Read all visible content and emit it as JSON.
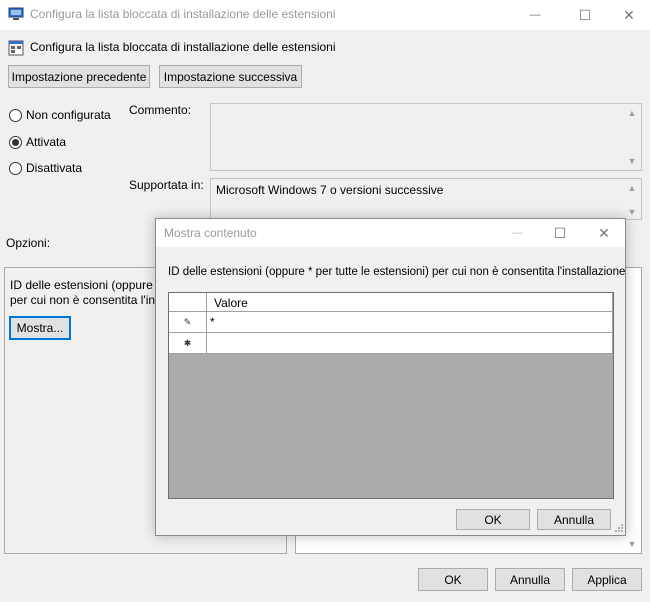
{
  "window": {
    "title": "Configura la lista bloccata di installazione delle estensioni",
    "minimize": "—",
    "maximize": "☐",
    "close": "✕"
  },
  "header": {
    "policy_title": "Configura la lista bloccata di installazione delle estensioni"
  },
  "nav": {
    "prev_label": "Impostazione precedente",
    "next_label": "Impostazione successiva"
  },
  "state": {
    "options": [
      {
        "label": "Non configurata",
        "checked": false
      },
      {
        "label": "Attivata",
        "checked": true
      },
      {
        "label": "Disattivata",
        "checked": false
      }
    ]
  },
  "comment": {
    "label": "Commento:",
    "value": ""
  },
  "supported": {
    "label": "Supportata in:",
    "value": "Microsoft Windows 7 o versioni successive"
  },
  "options_section": {
    "label": "Opzioni:",
    "description": "ID delle estensioni (oppure * per tutte le estensioni) per cui non è consentita l'installazione",
    "description_line1": "ID delle estensioni (oppure * p",
    "description_line2": "per cui non è consentita l'insta",
    "show_button": "Mostra..."
  },
  "footer": {
    "ok_label": "OK",
    "cancel_label": "Annulla",
    "apply_label": "Applica"
  },
  "dialog": {
    "title": "Mostra contenuto",
    "description": "ID delle estensioni (oppure * per tutte le estensioni) per cui non è consentita l'installazione",
    "column_header": "Valore",
    "rows": [
      {
        "marker": "✎",
        "value": "*"
      },
      {
        "marker": "✱",
        "value": ""
      }
    ],
    "ok_label": "OK",
    "cancel_label": "Annulla"
  }
}
